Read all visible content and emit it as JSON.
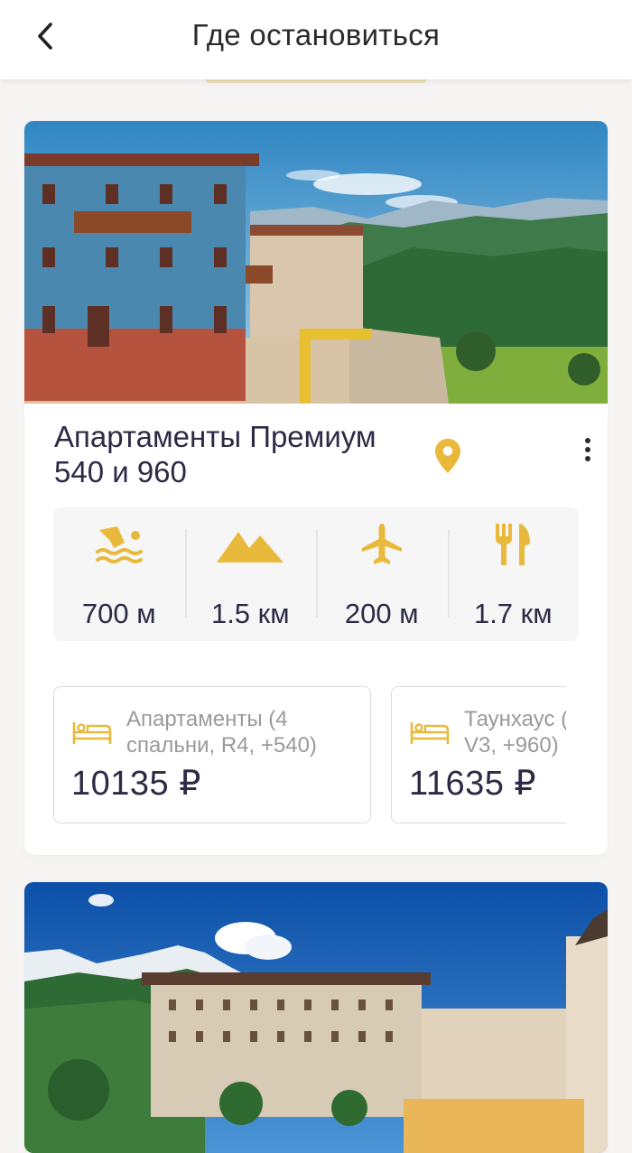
{
  "header": {
    "title": "Где остановиться",
    "back_icon": "chevron-left-icon"
  },
  "hotels": [
    {
      "name": "Апартаменты Премиум 540 и 960",
      "amenities": [
        {
          "icon": "swimming-icon",
          "distance": "700 м"
        },
        {
          "icon": "mountain-icon",
          "distance": "1.5 км"
        },
        {
          "icon": "airplane-icon",
          "distance": "200 м"
        },
        {
          "icon": "restaurant-icon",
          "distance": "1.7 км"
        }
      ],
      "offers": [
        {
          "type": "Апартаменты (4\nспальни, R4, +540)",
          "price": "10135 ₽"
        },
        {
          "type": "Таунхаус (\nV3, +960)",
          "price": "11635 ₽"
        }
      ]
    }
  ],
  "colors": {
    "accent": "#e8b93a",
    "text": "#2b2b45",
    "muted": "#9a9a9a"
  }
}
